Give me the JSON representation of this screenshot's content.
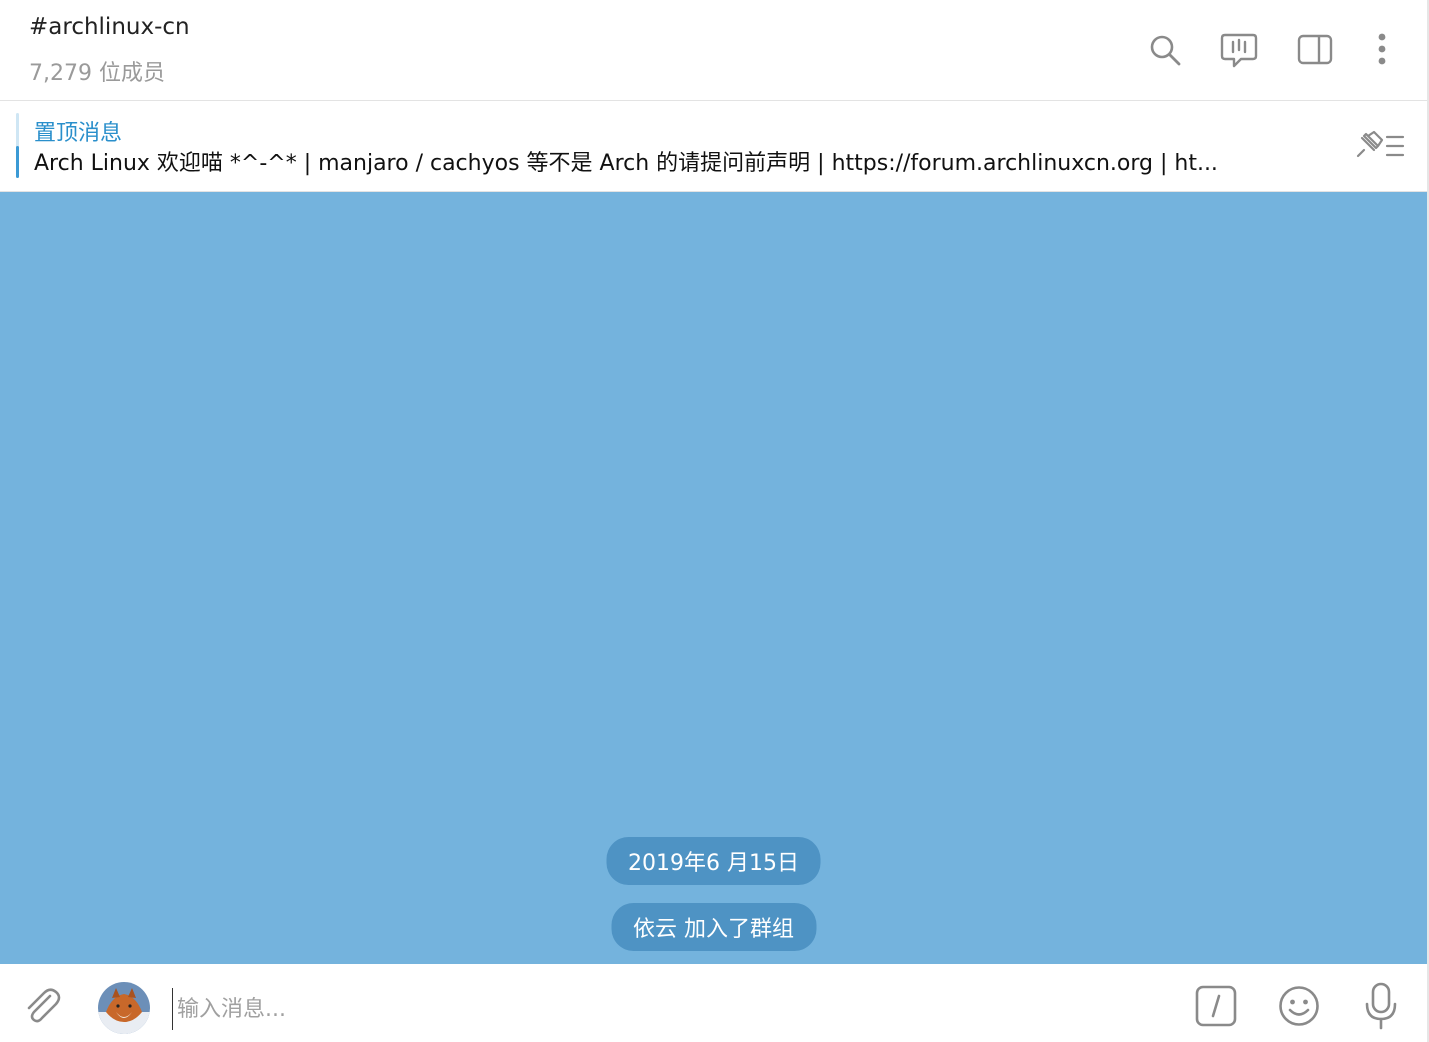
{
  "header": {
    "title": "#archlinux-cn",
    "subtitle": "7,279 位成员",
    "icons": [
      "search-icon",
      "video-chat-icon",
      "sidebar-toggle-icon",
      "more-vertical-icon"
    ]
  },
  "pinned": {
    "label": "置顶消息",
    "text": "Arch Linux 欢迎喵 *^-^* | manjaro / cachyos 等不是 Arch 的请提问前声明 | https://forum.archlinuxcn.org | ht..."
  },
  "chat": {
    "date_label": "2019年6 月15日",
    "service_message": "依云 加入了群组",
    "background_color": "#74b3dd",
    "pill_color": "#4e93c4"
  },
  "composer": {
    "placeholder": "输入消息...",
    "value": "",
    "icons": [
      "attach-icon",
      "avatar",
      "bot-command-icon",
      "emoji-icon",
      "microphone-icon"
    ]
  },
  "colors": {
    "accent": "#2a8fcb",
    "icon_gray": "#8a8a8a"
  }
}
